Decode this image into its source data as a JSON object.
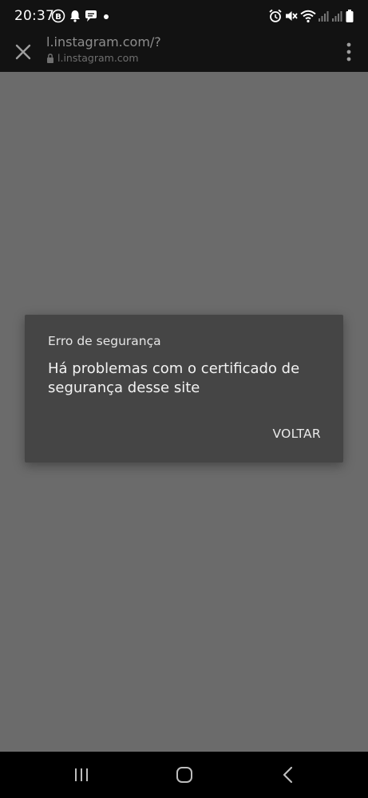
{
  "status_bar": {
    "time": "20:37",
    "left_icons": [
      "b-badge-icon",
      "notification-bell-icon",
      "chat-bubble-icon",
      "dot-icon"
    ],
    "right_icons": [
      "alarm-icon",
      "mute-icon",
      "wifi-icon",
      "signal-icon",
      "signal-icon",
      "battery-icon"
    ]
  },
  "toolbar": {
    "url": "l.instagram.com/?",
    "domain": "l.instagram.com"
  },
  "dialog": {
    "title": "Erro de segurança",
    "message": "Há problemas com o certificado de segurança desse site",
    "button_label": "VOLTAR"
  },
  "nav_bar": {
    "buttons": [
      "recents-icon",
      "home-icon",
      "back-icon"
    ]
  },
  "colors": {
    "background_dim": "#6b6b6b",
    "status_bar": "#121212",
    "dialog_bg": "#454545"
  }
}
